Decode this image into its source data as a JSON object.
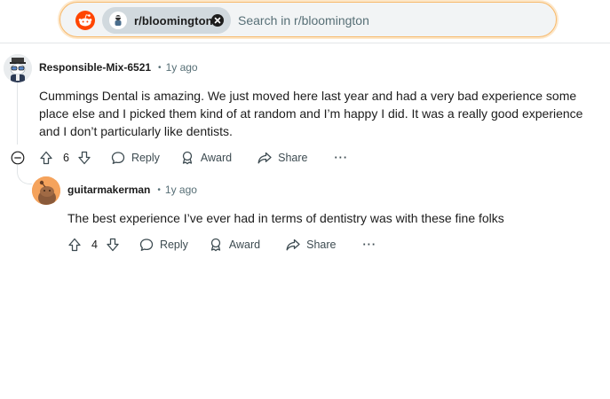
{
  "search": {
    "subreddit_chip": "r/bloomington",
    "placeholder": "Search in r/bloomington"
  },
  "comments": [
    {
      "username": "Responsible-Mix-6521",
      "time": "1y ago",
      "text_lines": [
        "Cummings Dental is amazing. We just moved here last year and had a very bad experience some",
        "place else and I picked them kind of at random and I’m happy I did. It was a really good experience",
        "and I don’t particularly like dentists."
      ],
      "votes": "6",
      "reply_label": "Reply",
      "award_label": "Award",
      "share_label": "Share",
      "more_label": "···"
    },
    {
      "username": "guitarmakerman",
      "time": "1y ago",
      "text_lines": [
        "The best experience I’ve ever had in terms of dentistry was with these fine folks"
      ],
      "votes": "4",
      "reply_label": "Reply",
      "award_label": "Award",
      "share_label": "Share",
      "more_label": "···"
    }
  ],
  "colors": {
    "reddit_orange": "#ff4500",
    "focus_ring": "#f7b96b",
    "meta_gray": "#576f76"
  }
}
